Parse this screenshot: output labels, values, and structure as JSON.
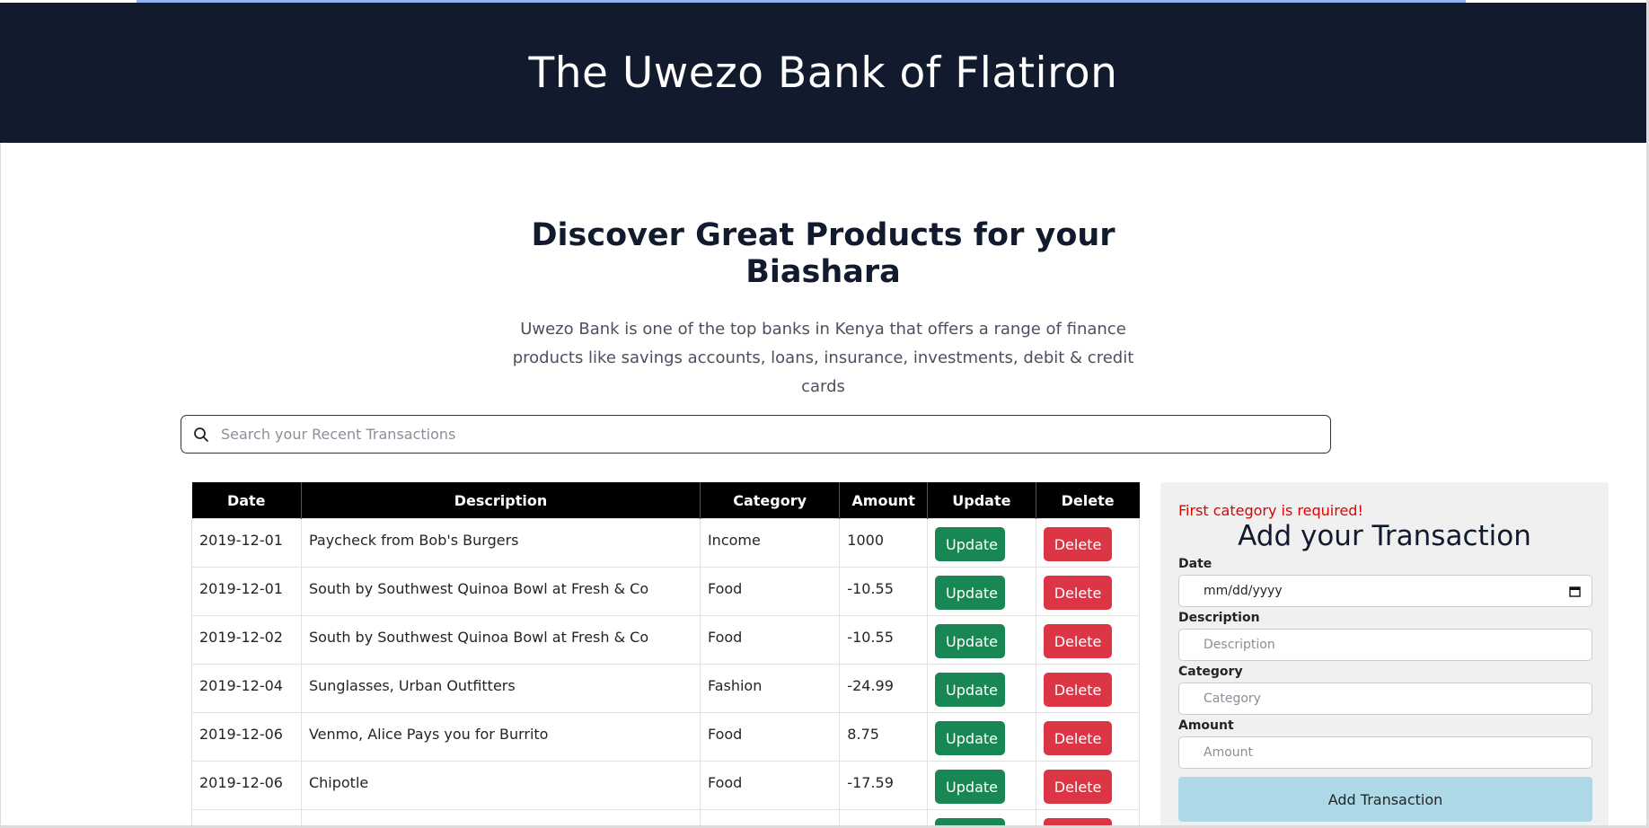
{
  "header": {
    "title": "The Uwezo Bank of Flatiron"
  },
  "hero": {
    "title": "Discover Great Products for your Biashara",
    "text": "Uwezo Bank is one of the top banks in Kenya that offers a range of finance products like savings accounts, loans, insurance, investments, debit & credit cards"
  },
  "search": {
    "placeholder": "Search your Recent Transactions",
    "icon": "search-icon"
  },
  "table": {
    "headers": [
      "Date",
      "Description",
      "Category",
      "Amount",
      "Update",
      "Delete"
    ],
    "update_label": "Update",
    "delete_label": "Delete",
    "rows": [
      {
        "date": "2019-12-01",
        "description": "Paycheck from Bob's Burgers",
        "category": "Income",
        "amount": "1000"
      },
      {
        "date": "2019-12-01",
        "description": "South by Southwest Quinoa Bowl at Fresh & Co",
        "category": "Food",
        "amount": "-10.55"
      },
      {
        "date": "2019-12-02",
        "description": "South by Southwest Quinoa Bowl at Fresh & Co",
        "category": "Food",
        "amount": "-10.55"
      },
      {
        "date": "2019-12-04",
        "description": "Sunglasses, Urban Outfitters",
        "category": "Fashion",
        "amount": "-24.99"
      },
      {
        "date": "2019-12-06",
        "description": "Venmo, Alice Pays you for Burrito",
        "category": "Food",
        "amount": "8.75"
      },
      {
        "date": "2019-12-06",
        "description": "Chipotle",
        "category": "Food",
        "amount": "-17.59"
      },
      {
        "date": "",
        "description": "",
        "category": "",
        "amount": ""
      }
    ]
  },
  "form": {
    "error": "First category is required!",
    "title": "Add your Transaction",
    "date_label": "Date",
    "date_value": "mm/dd/yyyy",
    "description_label": "Description",
    "description_placeholder": "Description",
    "category_label": "Category",
    "category_placeholder": "Category",
    "amount_label": "Amount",
    "amount_placeholder": "Amount",
    "submit_label": "Add Transaction"
  },
  "colors": {
    "header_bg": "#121a2e",
    "update_btn": "#198754",
    "delete_btn": "#dc3545",
    "submit_btn": "#add8e6",
    "error_text": "#e00000"
  }
}
